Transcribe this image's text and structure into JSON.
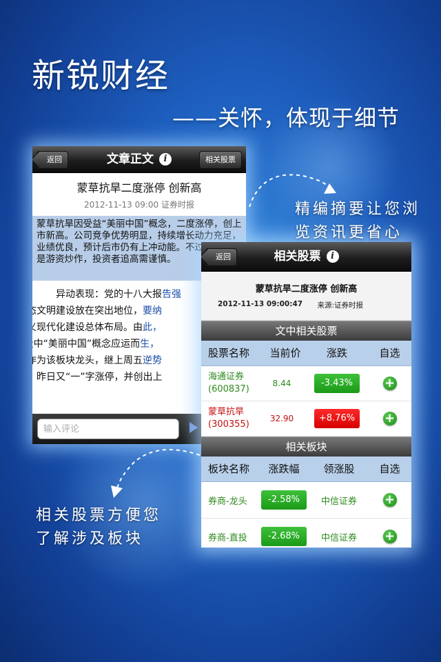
{
  "headline": {
    "app_name": "新锐财经",
    "slogan": "——关怀，体现于细节"
  },
  "captions": {
    "top_line1": "精编摘要让您浏",
    "top_line2": "览资讯更省心",
    "bottom_line1": "相关股票方便您",
    "bottom_line2": "了解涉及板块"
  },
  "article_screen": {
    "back_label": "返回",
    "title": "文章正文",
    "info_icon_glyph": "i",
    "right_button": "相关股票",
    "article_title": "蒙草抗旱二度涨停 创新高",
    "meta": "2012-11-13 09:00 证券时报",
    "summary": "蒙草抗旱因受益“美丽中国”概念，二度涨停，创上市新高。公司竞争优势明显，持续增长动力充足，业绩优良，预计后市仍有上冲动能。不过本次主要是游资炒作，投资者追高需谨慎。",
    "body_p1_a": "异动表现：党的十八大报",
    "body_p1_link1": "告强",
    "body_p1_b": "生态文明建设放在突出地位，",
    "body_p1_link2": "要纳",
    "body_p1_c": "主义现代化建设总体布局。由",
    "body_p1_link3": "此，",
    "body_p1_d": "A股中“美丽中国”概念应运而",
    "body_p1_link4": "生，",
    "body_p1_e": "草作为该板块龙头，继上周五",
    "body_p1_link5": "逆势",
    "body_p1_f": "后，昨日又“一”字涨停，并创出上",
    "body_p1_g": "高。",
    "comment_placeholder": "输入评论"
  },
  "stocks_screen": {
    "back_label": "返回",
    "title": "相关股票",
    "info_icon_glyph": "i",
    "article_title": "蒙草抗旱二度涨停 创新高",
    "date": "2012-11-13 09:00:47",
    "source": "来源:证券时报",
    "stocks_section": "文中相关股票",
    "stock_columns": [
      "股票名称",
      "当前价",
      "涨跌",
      "自选"
    ],
    "stocks": [
      {
        "name": "海通证券",
        "code": "(600837)",
        "price": "8.44",
        "change": "-3.43%",
        "trend": "down"
      },
      {
        "name": "蒙草抗旱",
        "code": "(300355)",
        "price": "32.90",
        "change": "+8.76%",
        "trend": "up"
      }
    ],
    "sectors_section": "相关板块",
    "sector_columns": [
      "板块名称",
      "涨跌幅",
      "领涨股",
      "自选"
    ],
    "sectors": [
      {
        "name": "券商-龙头",
        "change": "-2.58%",
        "leader": "中信证券"
      },
      {
        "name": "券商-直投",
        "change": "-2.68%",
        "leader": "中信证券"
      }
    ],
    "add_glyph": "+"
  },
  "colors": {
    "up": "#d50000",
    "down": "#1b9a18",
    "highlight": "#b8cde8",
    "background": "#1e5fbf"
  }
}
